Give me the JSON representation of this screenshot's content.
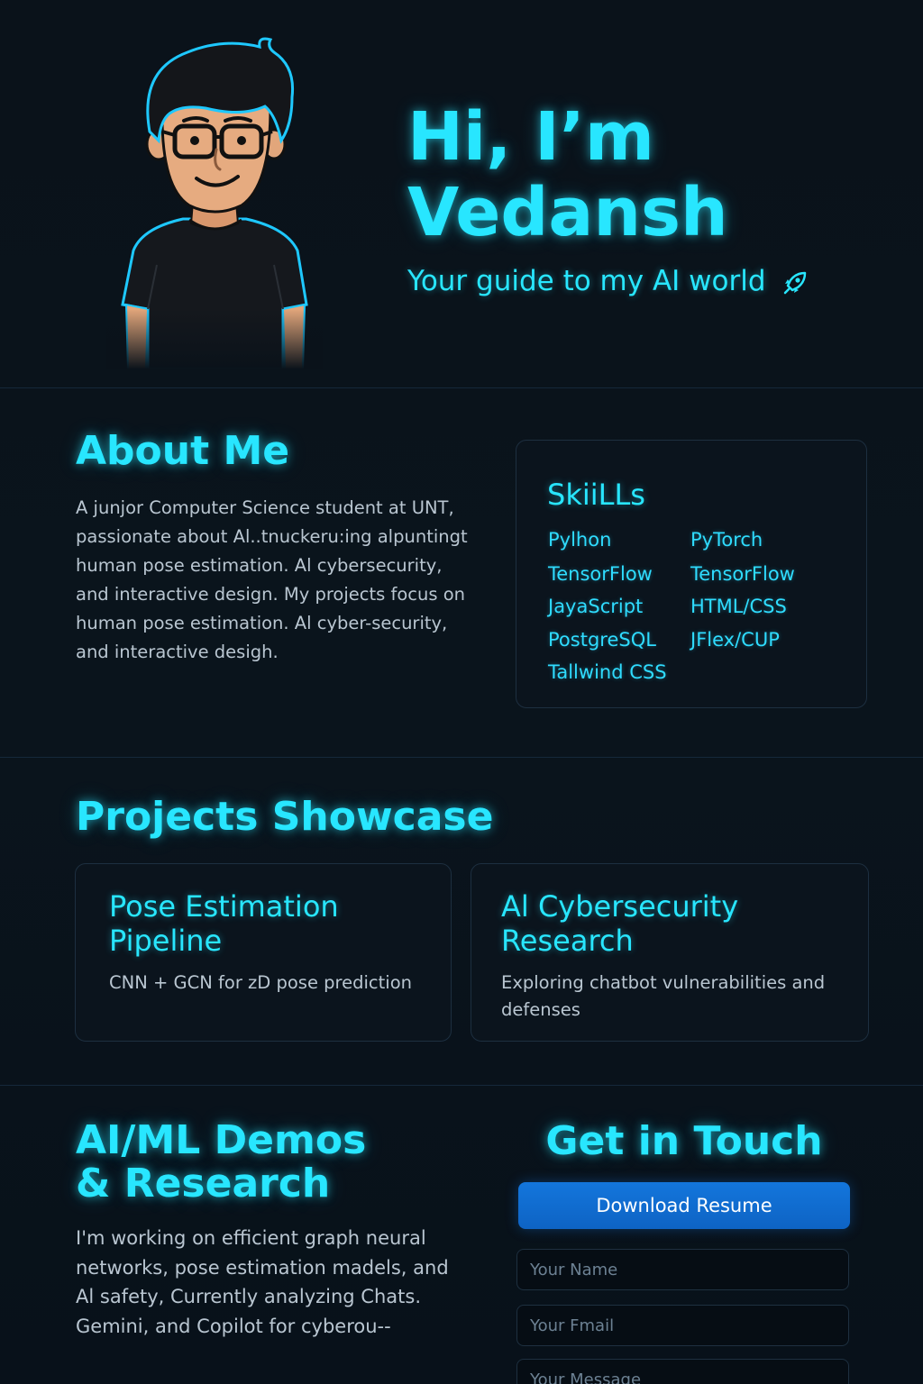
{
  "hero": {
    "title_line1": "Hi, I’m",
    "title_line2": "Vedansh",
    "subtitle": "Your guide to my AI world",
    "subtitle_icon": "rocket-icon"
  },
  "about": {
    "heading": "About Me",
    "text": "A junjor Computer Science student at UNT, passionate about Al..tnuckeru:ing alpuntingt human pose estimation. Al cybersecurity, and interactive design. My projects focus on human pose estimation. Al cyber-security, and interactive desigh."
  },
  "skills": {
    "heading": "SkiiLLs",
    "left": [
      "Pylhon",
      "TensorFlow",
      "JayaScript",
      "PostgreSQL",
      "Tallwind CSS"
    ],
    "right": [
      "PyTorch",
      "TensorFlow",
      "HTML/CSS",
      "JFlex/CUP"
    ]
  },
  "projects": {
    "heading": "Projects Showcase",
    "items": [
      {
        "title_line1": "Pose Estimation",
        "title_line2": "Pipeline",
        "description": "CNN + GCN for zD pose prediction"
      },
      {
        "title_line1": "Al Cybersecurity",
        "title_line2": "Research",
        "description": "Exploring chatbot vulnerabilities and defenses"
      }
    ]
  },
  "demos": {
    "heading_line1": "AI/ML Demos",
    "heading_line2": "& Research",
    "text": "I'm working on efficient graph neural networks, pose estimation madels, and Al safety, Currently analyzing Chats. Gemini, and Copilot for cyberou--"
  },
  "contact": {
    "heading": "Get in Touch",
    "download_label": "Download Resume",
    "name_placeholder": "Your Name",
    "email_placeholder": "Your Fmail",
    "message_placeholder": "Your Message"
  },
  "colors": {
    "accent": "#28e6ff",
    "button": "#1376dc",
    "background": "#0a121a"
  }
}
